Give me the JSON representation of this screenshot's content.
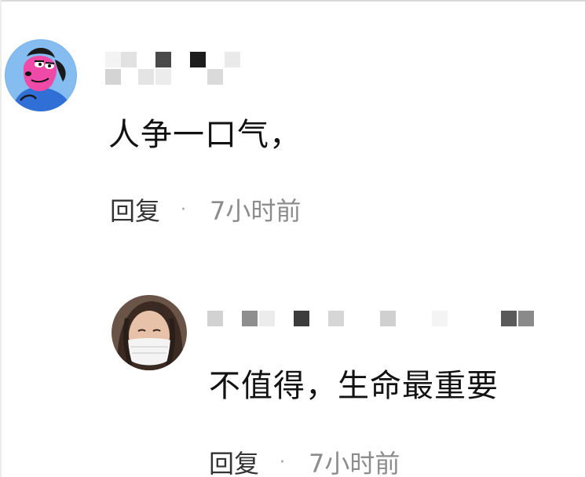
{
  "comments": [
    {
      "avatar_icon": "cartoon-dog-avatar-icon",
      "username_redacted": true,
      "text": "人争一口气，",
      "reply_label": "回复",
      "separator": "·",
      "time": "7小时前"
    },
    {
      "avatar_icon": "masked-woman-avatar-icon",
      "username_redacted": true,
      "text": "不值得，生命最重要",
      "reply_label": "回复",
      "separator": "·",
      "time": "7小时前"
    }
  ],
  "colors": {
    "avatar1_bg": "#7ab3e8",
    "avatar1_character": "#f04aa8",
    "avatar1_body": "#2f6fd6",
    "meta_time": "#8c8c8c",
    "reply_text": "#333333"
  }
}
